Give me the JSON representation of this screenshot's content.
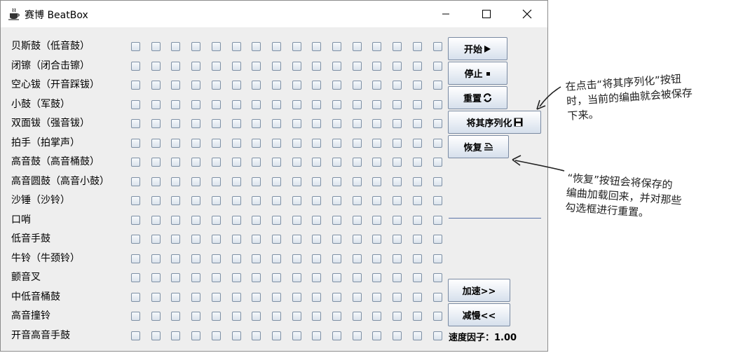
{
  "window": {
    "title": "赛博 BeatBox"
  },
  "instruments": [
    "贝斯鼓（低音鼓）",
    "闭镲（闭合击镲）",
    "空心钹（开音踩钹）",
    "小鼓（军鼓）",
    "双面钹（强音钹）",
    "拍手（拍掌声）",
    "高音鼓（高音桶鼓）",
    "高音圆鼓（高音小鼓）",
    "沙锤（沙铃）",
    "口哨",
    "低音手鼓",
    "牛铃（牛颈铃）",
    "颤音叉",
    "中低音桶鼓",
    "高音撞铃",
    "开音高音手鼓"
  ],
  "beats_per_row": 16,
  "checked": [],
  "buttons": {
    "start": "开始",
    "stop": "停止",
    "reset": "重置",
    "save": "将其序列化",
    "restore": "恢复",
    "faster": "加速>>",
    "slower": "减慢<<"
  },
  "speed": {
    "label": "速度因子：1.00"
  },
  "annotations": {
    "save": [
      "在点击“将其序列化”按钮",
      "时，当前的编曲就会被保存",
      "下来。"
    ],
    "restore": [
      "“恢复”按钮会将保存的",
      "编曲加载回来，并对那些",
      "勾选框进行重置。"
    ]
  }
}
